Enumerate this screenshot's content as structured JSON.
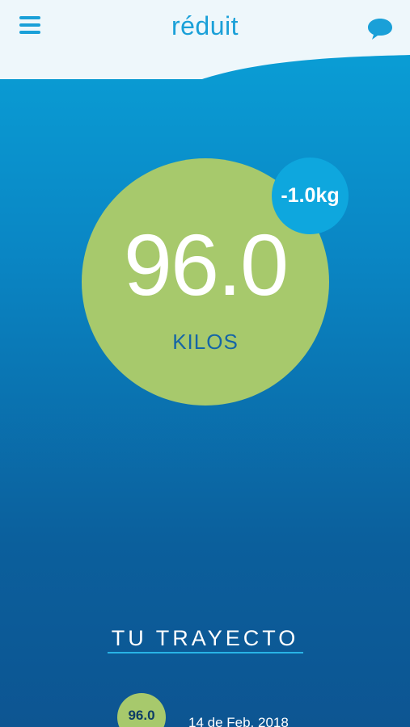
{
  "header": {
    "logo_text": "réduit",
    "menu_icon": "hamburger-menu-icon",
    "chat_icon": "chat-bubble-icon",
    "colors": {
      "header_bg": "#eef7fb",
      "accent": "#1aa0d8"
    }
  },
  "weight": {
    "value": "96.0",
    "unit": "KILOS",
    "change": "-1.0kg",
    "circle_color": "#a7c96c",
    "badge_color": "#0ea7de"
  },
  "journey": {
    "title": "TU TRAYECTO",
    "entries": [
      {
        "value": "96.0",
        "date": "14 de Feb, 2018"
      }
    ]
  }
}
